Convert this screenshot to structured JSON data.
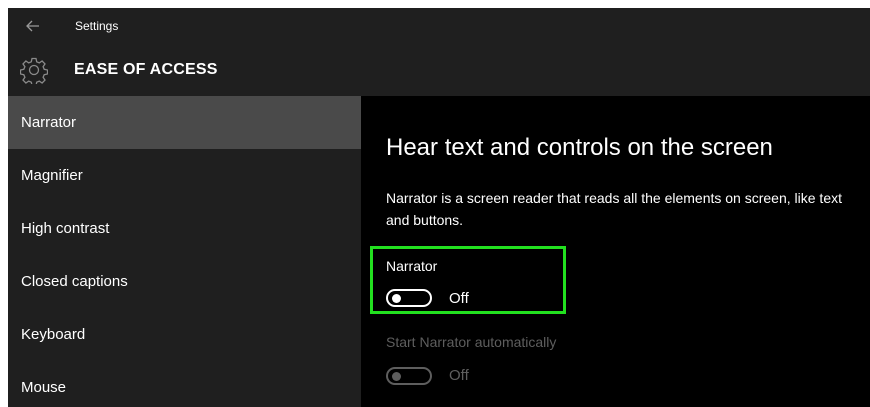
{
  "window": {
    "title": "Settings",
    "back_icon": "back-arrow-icon"
  },
  "header": {
    "icon": "gear-icon",
    "title": "EASE OF ACCESS"
  },
  "sidebar": {
    "items": [
      {
        "label": "Narrator",
        "selected": true
      },
      {
        "label": "Magnifier",
        "selected": false
      },
      {
        "label": "High contrast",
        "selected": false
      },
      {
        "label": "Closed captions",
        "selected": false
      },
      {
        "label": "Keyboard",
        "selected": false
      },
      {
        "label": "Mouse",
        "selected": false
      }
    ]
  },
  "content": {
    "heading": "Hear text and controls on the screen",
    "description": "Narrator is a screen reader that reads all the elements on screen, like text and buttons.",
    "narrator_setting": {
      "label": "Narrator",
      "state": "Off",
      "highlighted": true
    },
    "auto_start_setting": {
      "label": "Start Narrator automatically",
      "state": "Off",
      "enabled": false
    }
  },
  "colors": {
    "highlight": "#22e01f",
    "sidebar_selected": "#4a4a4a",
    "content_bg": "#000000",
    "chrome_bg": "#1f1f1f"
  }
}
